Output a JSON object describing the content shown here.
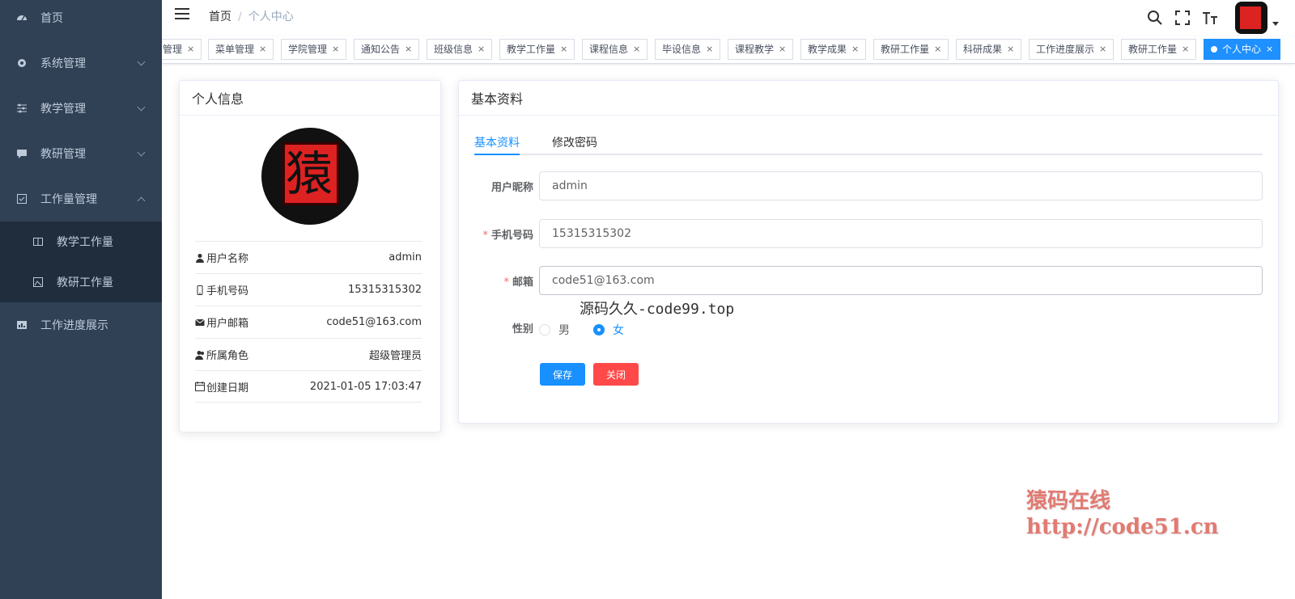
{
  "sidebar": {
    "items": [
      {
        "label": "首页",
        "icon": "dashboard-icon"
      },
      {
        "label": "系统管理",
        "icon": "gear-icon"
      },
      {
        "label": "教学管理",
        "icon": "sliders-icon"
      },
      {
        "label": "教研管理",
        "icon": "chat-icon"
      },
      {
        "label": "工作量管理",
        "icon": "checkbox-icon"
      },
      {
        "label": "工作进度展示",
        "icon": "chart-icon"
      }
    ],
    "submenu": [
      {
        "label": "教学工作量",
        "icon": "columns-icon"
      },
      {
        "label": "教研工作量",
        "icon": "image-icon"
      }
    ]
  },
  "navbar": {
    "breadcrumb_home": "首页",
    "breadcrumb_sep": "/",
    "breadcrumb_current": "个人中心"
  },
  "tags": [
    "管理",
    "菜单管理",
    "学院管理",
    "通知公告",
    "班级信息",
    "教学工作量",
    "课程信息",
    "毕设信息",
    "课程教学",
    "教学成果",
    "教研工作量",
    "科研成果",
    "工作进度展示",
    "教研工作量",
    "个人中心"
  ],
  "tag_close": "×",
  "profile": {
    "title": "个人信息",
    "rows": [
      {
        "label": "用户名称",
        "value": "admin",
        "icon": "user-icon"
      },
      {
        "label": "手机号码",
        "value": "15315315302",
        "icon": "phone-icon"
      },
      {
        "label": "用户邮箱",
        "value": "code51@163.com",
        "icon": "mail-icon"
      },
      {
        "label": "所属角色",
        "value": "超级管理员",
        "icon": "role-icon"
      },
      {
        "label": "创建日期",
        "value": "2021-01-05 17:03:47",
        "icon": "calendar-icon"
      }
    ]
  },
  "basic": {
    "title": "基本资料",
    "tabs": [
      "基本资料",
      "修改密码"
    ],
    "nickname_label": "用户昵称",
    "nickname_value": "admin",
    "phone_label": "手机号码",
    "phone_value": "15315315302",
    "email_label": "邮箱",
    "email_value": "code51@163.com",
    "gender_label": "性别",
    "gender_options": [
      "男",
      "女"
    ],
    "gender_selected": "女",
    "save_label": "保存",
    "close_label": "关闭",
    "required_mark": "*"
  },
  "watermarks": {
    "line1": "源码久久-code99.top",
    "line2a": "猿码在线",
    "line2b": "http://code51.cn"
  },
  "colors": {
    "sidebar_bg": "#304156",
    "accent": "#1890ff",
    "danger": "#ff4949",
    "tag_active": "#1e90ff"
  }
}
